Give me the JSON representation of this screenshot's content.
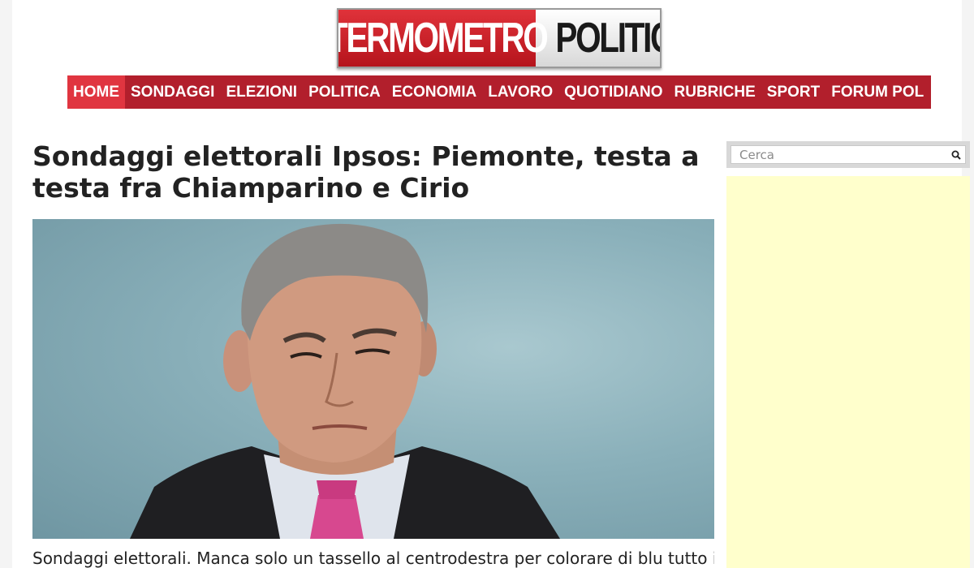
{
  "logo": {
    "part1": "TERMOMETRO",
    "part2": "POLITICO"
  },
  "nav": {
    "items": [
      {
        "label": "HOME",
        "active": true
      },
      {
        "label": "SONDAGGI",
        "active": false
      },
      {
        "label": "ELEZIONI",
        "active": false
      },
      {
        "label": "POLITICA",
        "active": false
      },
      {
        "label": "ECONOMIA",
        "active": false
      },
      {
        "label": "LAVORO",
        "active": false
      },
      {
        "label": "QUOTIDIANO",
        "active": false
      },
      {
        "label": "RUBRICHE",
        "active": false
      },
      {
        "label": "SPORT",
        "active": false
      },
      {
        "label": "FORUM POL",
        "active": false
      }
    ]
  },
  "article": {
    "title": "Sondaggi elettorali Ipsos: Piemonte, testa a testa fra Chiamparino e Cirio",
    "lead": "Sondaggi elettorali. Manca solo un tassello al centrodestra per colorare di blu tutto il"
  },
  "search": {
    "placeholder": "Cerca",
    "icon": "search-icon"
  },
  "colors": {
    "nav_bg": "#b21f2c",
    "nav_active": "#e03540",
    "ad_bg": "#ffffcc"
  }
}
